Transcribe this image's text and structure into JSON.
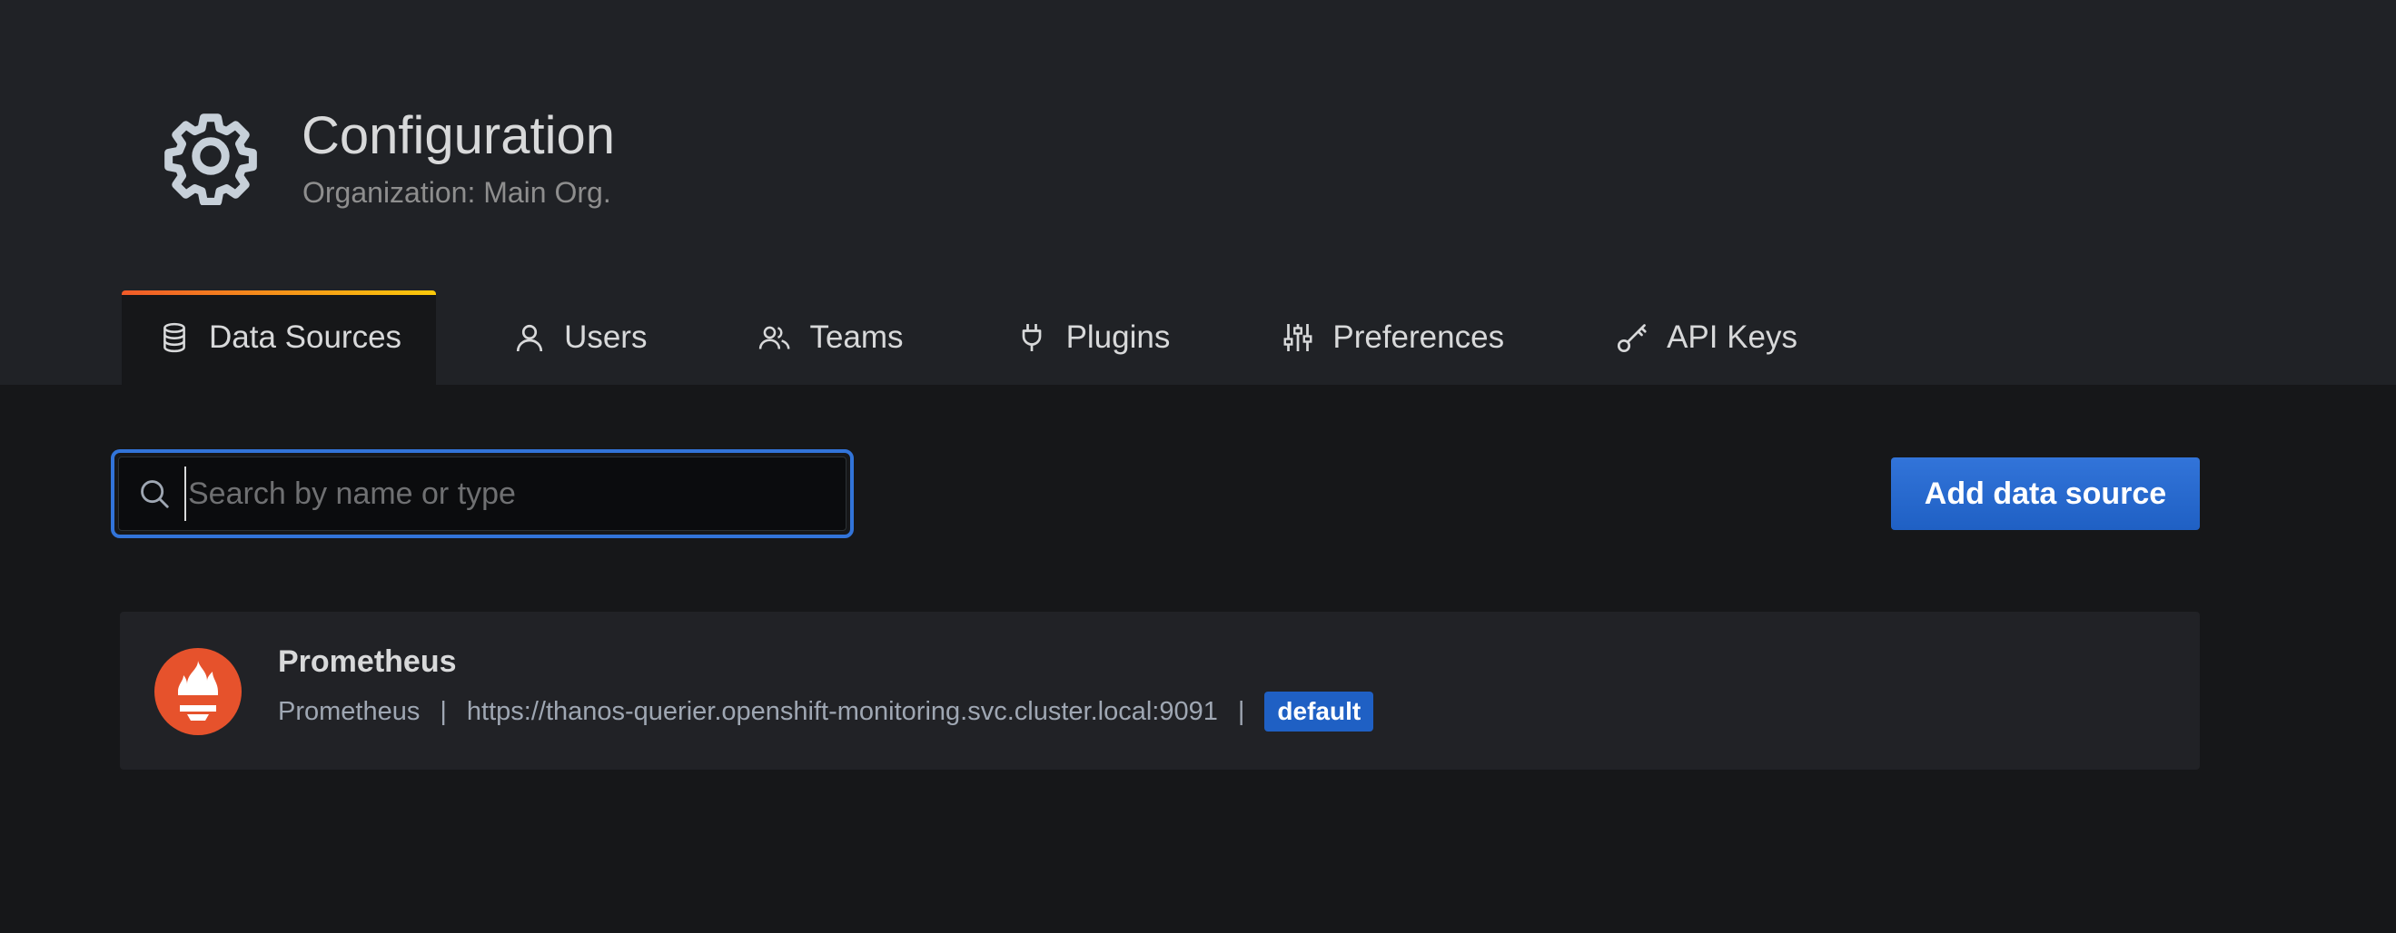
{
  "header": {
    "icon": "gear-icon",
    "title": "Configuration",
    "subtitle": "Organization: Main Org."
  },
  "tabs": [
    {
      "label": "Data Sources",
      "icon": "database-icon",
      "active": true
    },
    {
      "label": "Users",
      "icon": "user-icon",
      "active": false
    },
    {
      "label": "Teams",
      "icon": "users-icon",
      "active": false
    },
    {
      "label": "Plugins",
      "icon": "plug-icon",
      "active": false
    },
    {
      "label": "Preferences",
      "icon": "sliders-icon",
      "active": false
    },
    {
      "label": "API Keys",
      "icon": "key-icon",
      "active": false
    }
  ],
  "toolbar": {
    "search": {
      "placeholder": "Search by name or type",
      "value": ""
    },
    "add_button_label": "Add data source"
  },
  "data_sources": [
    {
      "name": "Prometheus",
      "type": "Prometheus",
      "url": "https://thanos-querier.openshift-monitoring.svc.cluster.local:9091",
      "separator": "|",
      "badge": "default",
      "logo": "prometheus-logo"
    }
  ],
  "colors": {
    "accent": "#3274d9",
    "prometheus": "#e6522c",
    "tab_gradient_start": "#f05a28",
    "tab_gradient_end": "#fbca0a"
  }
}
